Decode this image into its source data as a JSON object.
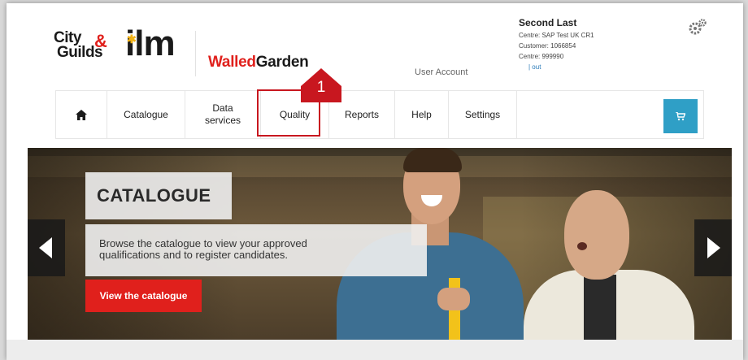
{
  "brand": {
    "city_line1": "City",
    "city_line2": "Guilds",
    "ilm": "ilm",
    "walled_part1": "Walled",
    "walled_part2": "Garden",
    "red": "#e0201c"
  },
  "header": {
    "user_account_label": "User Account",
    "account": {
      "name": "Second Last",
      "centre_line": "Centre:  SAP Test UK CR1",
      "customer_line": "Customer:  1066854",
      "centre_id_line": "Centre:  999990",
      "logout_label": "| out"
    },
    "settings_icon": "gears-icon"
  },
  "nav": {
    "home_icon": "home-icon",
    "items": [
      {
        "label": "Catalogue"
      },
      {
        "label": "Data services"
      },
      {
        "label": "Quality"
      },
      {
        "label": "Reports"
      },
      {
        "label": "Help"
      },
      {
        "label": "Settings"
      }
    ],
    "cart_icon": "cart-icon",
    "cart_color": "#2f9fc6"
  },
  "annotation": {
    "step_number": "1",
    "highlight_color": "#c8171f"
  },
  "hero": {
    "title": "CATALOGUE",
    "description": "Browse the catalogue to view your approved qualifications and to register candidates.",
    "cta_label": "View the catalogue",
    "prev_icon": "chevron-left-icon",
    "next_icon": "chevron-right-icon"
  }
}
